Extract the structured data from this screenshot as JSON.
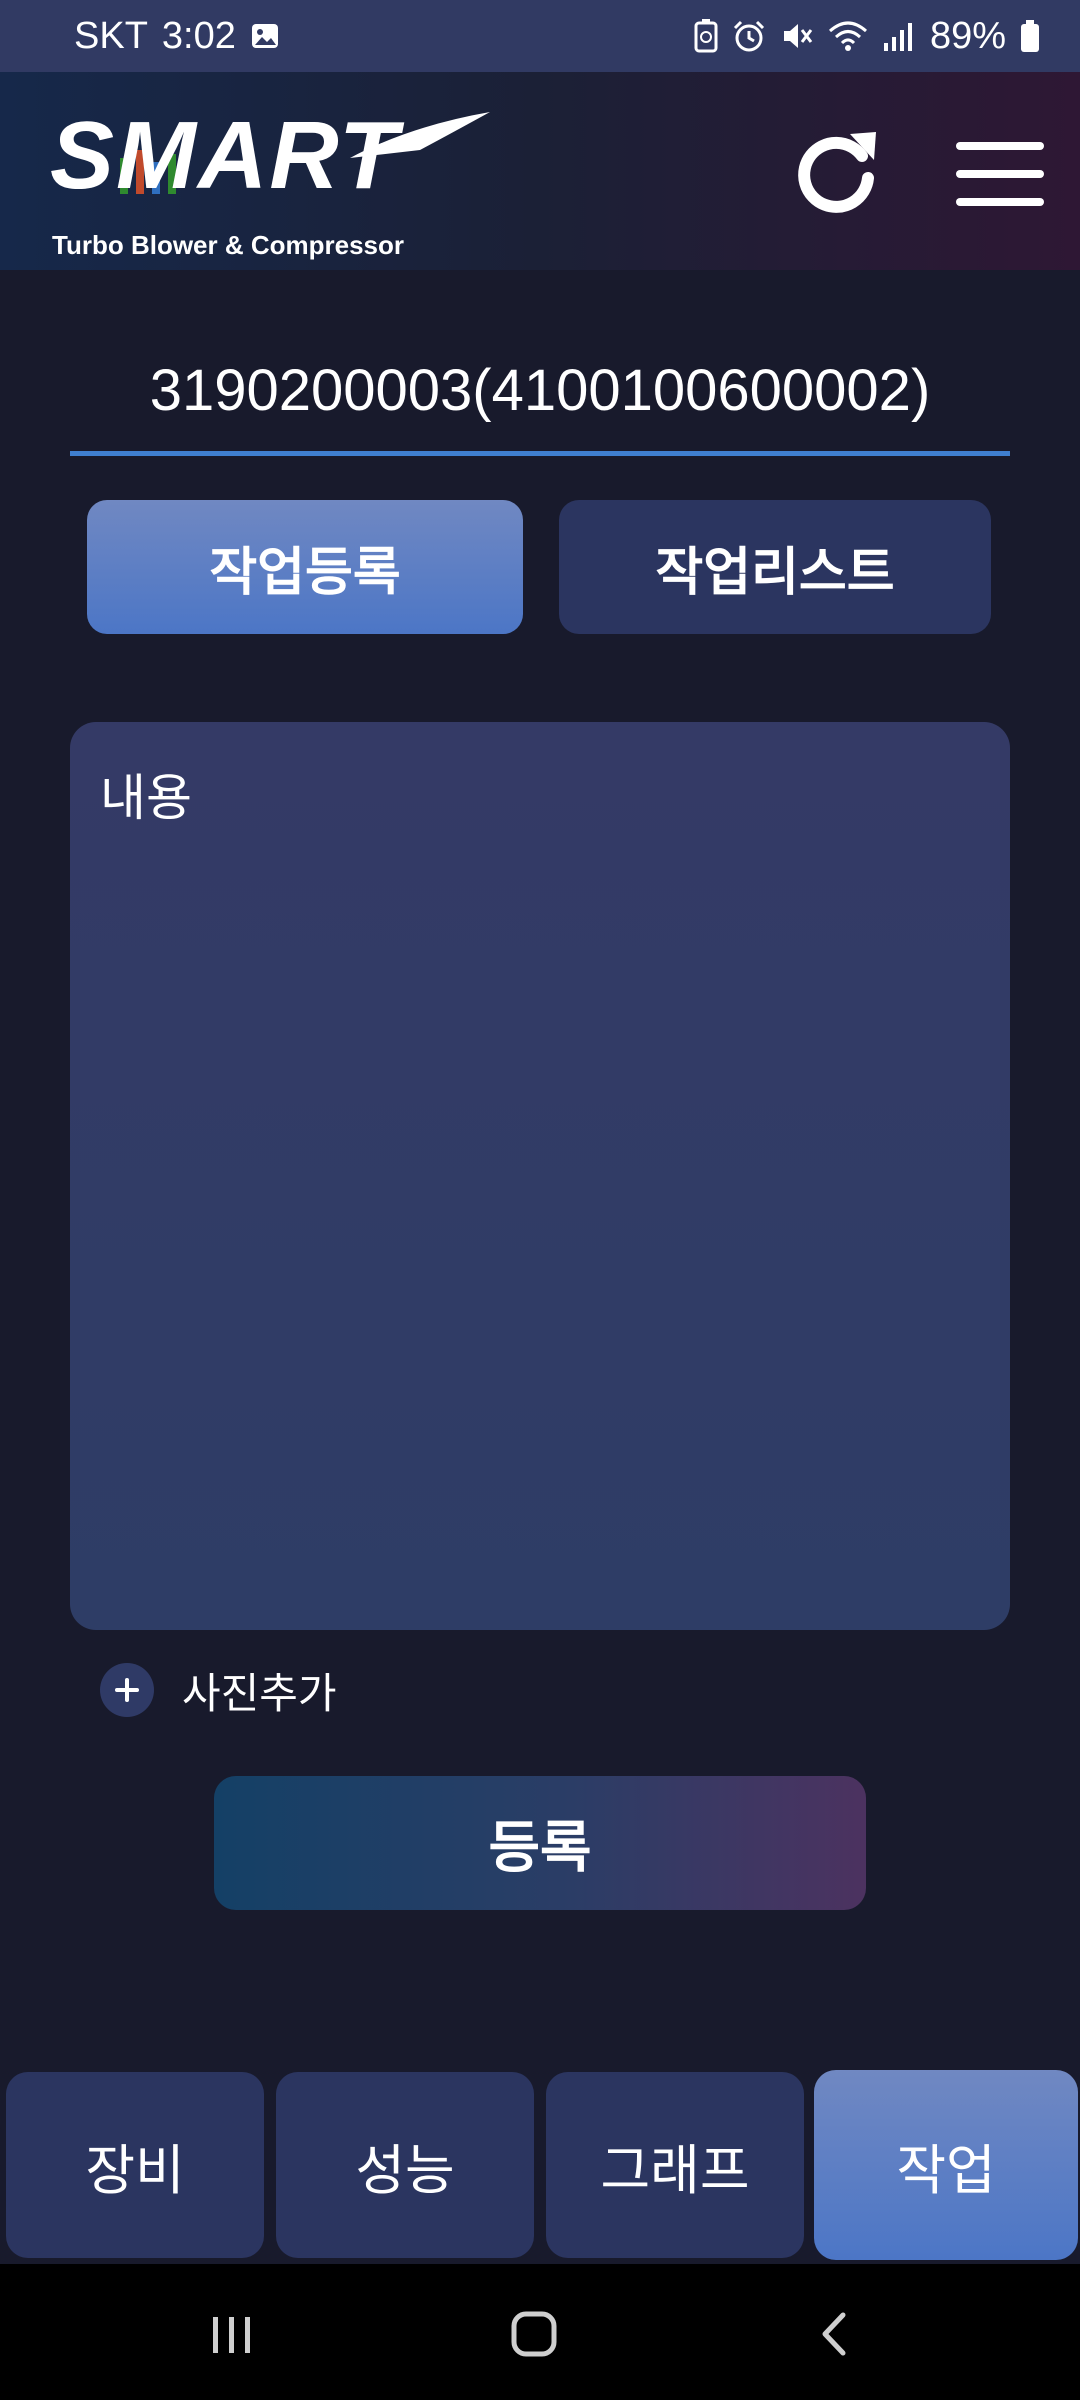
{
  "status_bar": {
    "carrier": "SKT",
    "time": "3:02",
    "battery": "89%",
    "icons": [
      "image-icon",
      "battery-saver-icon",
      "alarm-icon",
      "mute-icon",
      "wifi-icon",
      "signal-icon",
      "battery-icon"
    ]
  },
  "header": {
    "logo_text": "SMART",
    "logo_subtitle": "Turbo Blower & Compressor",
    "icons": [
      "refresh-icon",
      "hamburger-menu-icon"
    ]
  },
  "device_id": "3190200003(4100100600002)",
  "tabs": [
    {
      "label": "작업등록",
      "active": true
    },
    {
      "label": "작업리스트",
      "active": false
    }
  ],
  "content": {
    "placeholder": "내용",
    "value": ""
  },
  "add_photo": {
    "label": "사진추가",
    "icon": "plus-circle-icon"
  },
  "submit": {
    "label": "등록"
  },
  "bottom_nav": [
    {
      "label": "장비",
      "active": false
    },
    {
      "label": "성능",
      "active": false
    },
    {
      "label": "그래프",
      "active": false
    },
    {
      "label": "작업",
      "active": true
    }
  ],
  "system_nav": [
    "recent-apps-icon",
    "home-icon",
    "back-icon"
  ],
  "colors": {
    "background": "#181a2c",
    "status_bar": "#313a63",
    "accent_blue": "#4c76c6",
    "inactive_button": "#2b3560",
    "underline": "#3f7fd0"
  }
}
